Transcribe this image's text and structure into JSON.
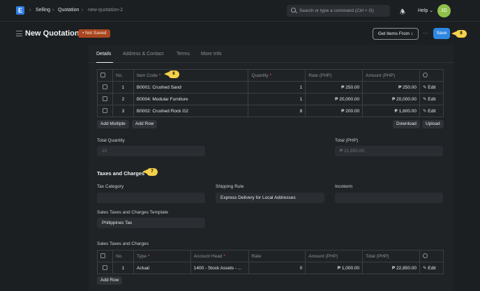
{
  "topbar": {
    "logo": "E",
    "crumbs": [
      "Selling",
      "Quotation",
      "new-quotation-2"
    ],
    "search_placeholder": "Search or type a command (Ctrl + G)",
    "help": "Help",
    "avatar": "JG"
  },
  "header": {
    "title": "New Quotation",
    "status": "Not Saved",
    "get_items": "Get Items From",
    "save": "Save",
    "more": "···"
  },
  "annotations": {
    "save": "8",
    "item_code": "6",
    "taxes": "7"
  },
  "tabs": [
    "Details",
    "Address & Contact",
    "Terms",
    "More Info"
  ],
  "items_table": {
    "headers": {
      "no": "No.",
      "item_code": "Item Code",
      "quantity": "Quantity",
      "rate": "Rate (PHP)",
      "amount": "Amount (PHP)"
    },
    "rows": [
      {
        "no": "1",
        "item": "B0001: Crushed Sand",
        "qty": "1",
        "rate": "₱ 250.00",
        "amount": "₱ 250.00",
        "edit": "Edit"
      },
      {
        "no": "2",
        "item": "B0004: Modular Furniture",
        "qty": "1",
        "rate": "₱ 20,000.00",
        "amount": "₱ 20,000.00",
        "edit": "Edit"
      },
      {
        "no": "3",
        "item": "B0002: Crushed Rock G2",
        "qty": "8",
        "rate": "₱ 200.00",
        "amount": "₱ 1,600.00",
        "edit": "Edit"
      }
    ],
    "add_multiple": "Add Multiple",
    "add_row": "Add Row",
    "download": "Download",
    "upload": "Upload"
  },
  "totals": {
    "total_quantity_label": "Total Quantity",
    "total_quantity": "10",
    "total_label": "Total (PHP)",
    "total": "₱ 21,850.00"
  },
  "taxes": {
    "section_title": "Taxes and Charges",
    "tax_category_label": "Tax Category",
    "tax_category": "",
    "shipping_rule_label": "Shipping Rule",
    "shipping_rule": "Express Delivery for Local Addresses",
    "incoterm_label": "Incoterm",
    "incoterm": "",
    "template_label": "Sales Taxes and Charges Template",
    "template": "Philippines Tax",
    "table_label": "Sales Taxes and Charges",
    "headers": {
      "no": "No.",
      "type": "Type",
      "account_head": "Account Head",
      "rate": "Rate",
      "amount": "Amount (PHP)",
      "total": "Total (PHP)"
    },
    "rows": [
      {
        "no": "1",
        "type": "Actual",
        "account": "1400 - Stock Assets - ...",
        "rate": "0",
        "amount": "₱ 1,000.00",
        "total": "₱ 22,850.00",
        "edit": "Edit"
      }
    ],
    "add_row": "Add Row"
  },
  "colors": {
    "accent": "#2e87e0",
    "badge": "#a9461f",
    "tag": "#f5d04a",
    "avatar": "#8fc14a"
  }
}
